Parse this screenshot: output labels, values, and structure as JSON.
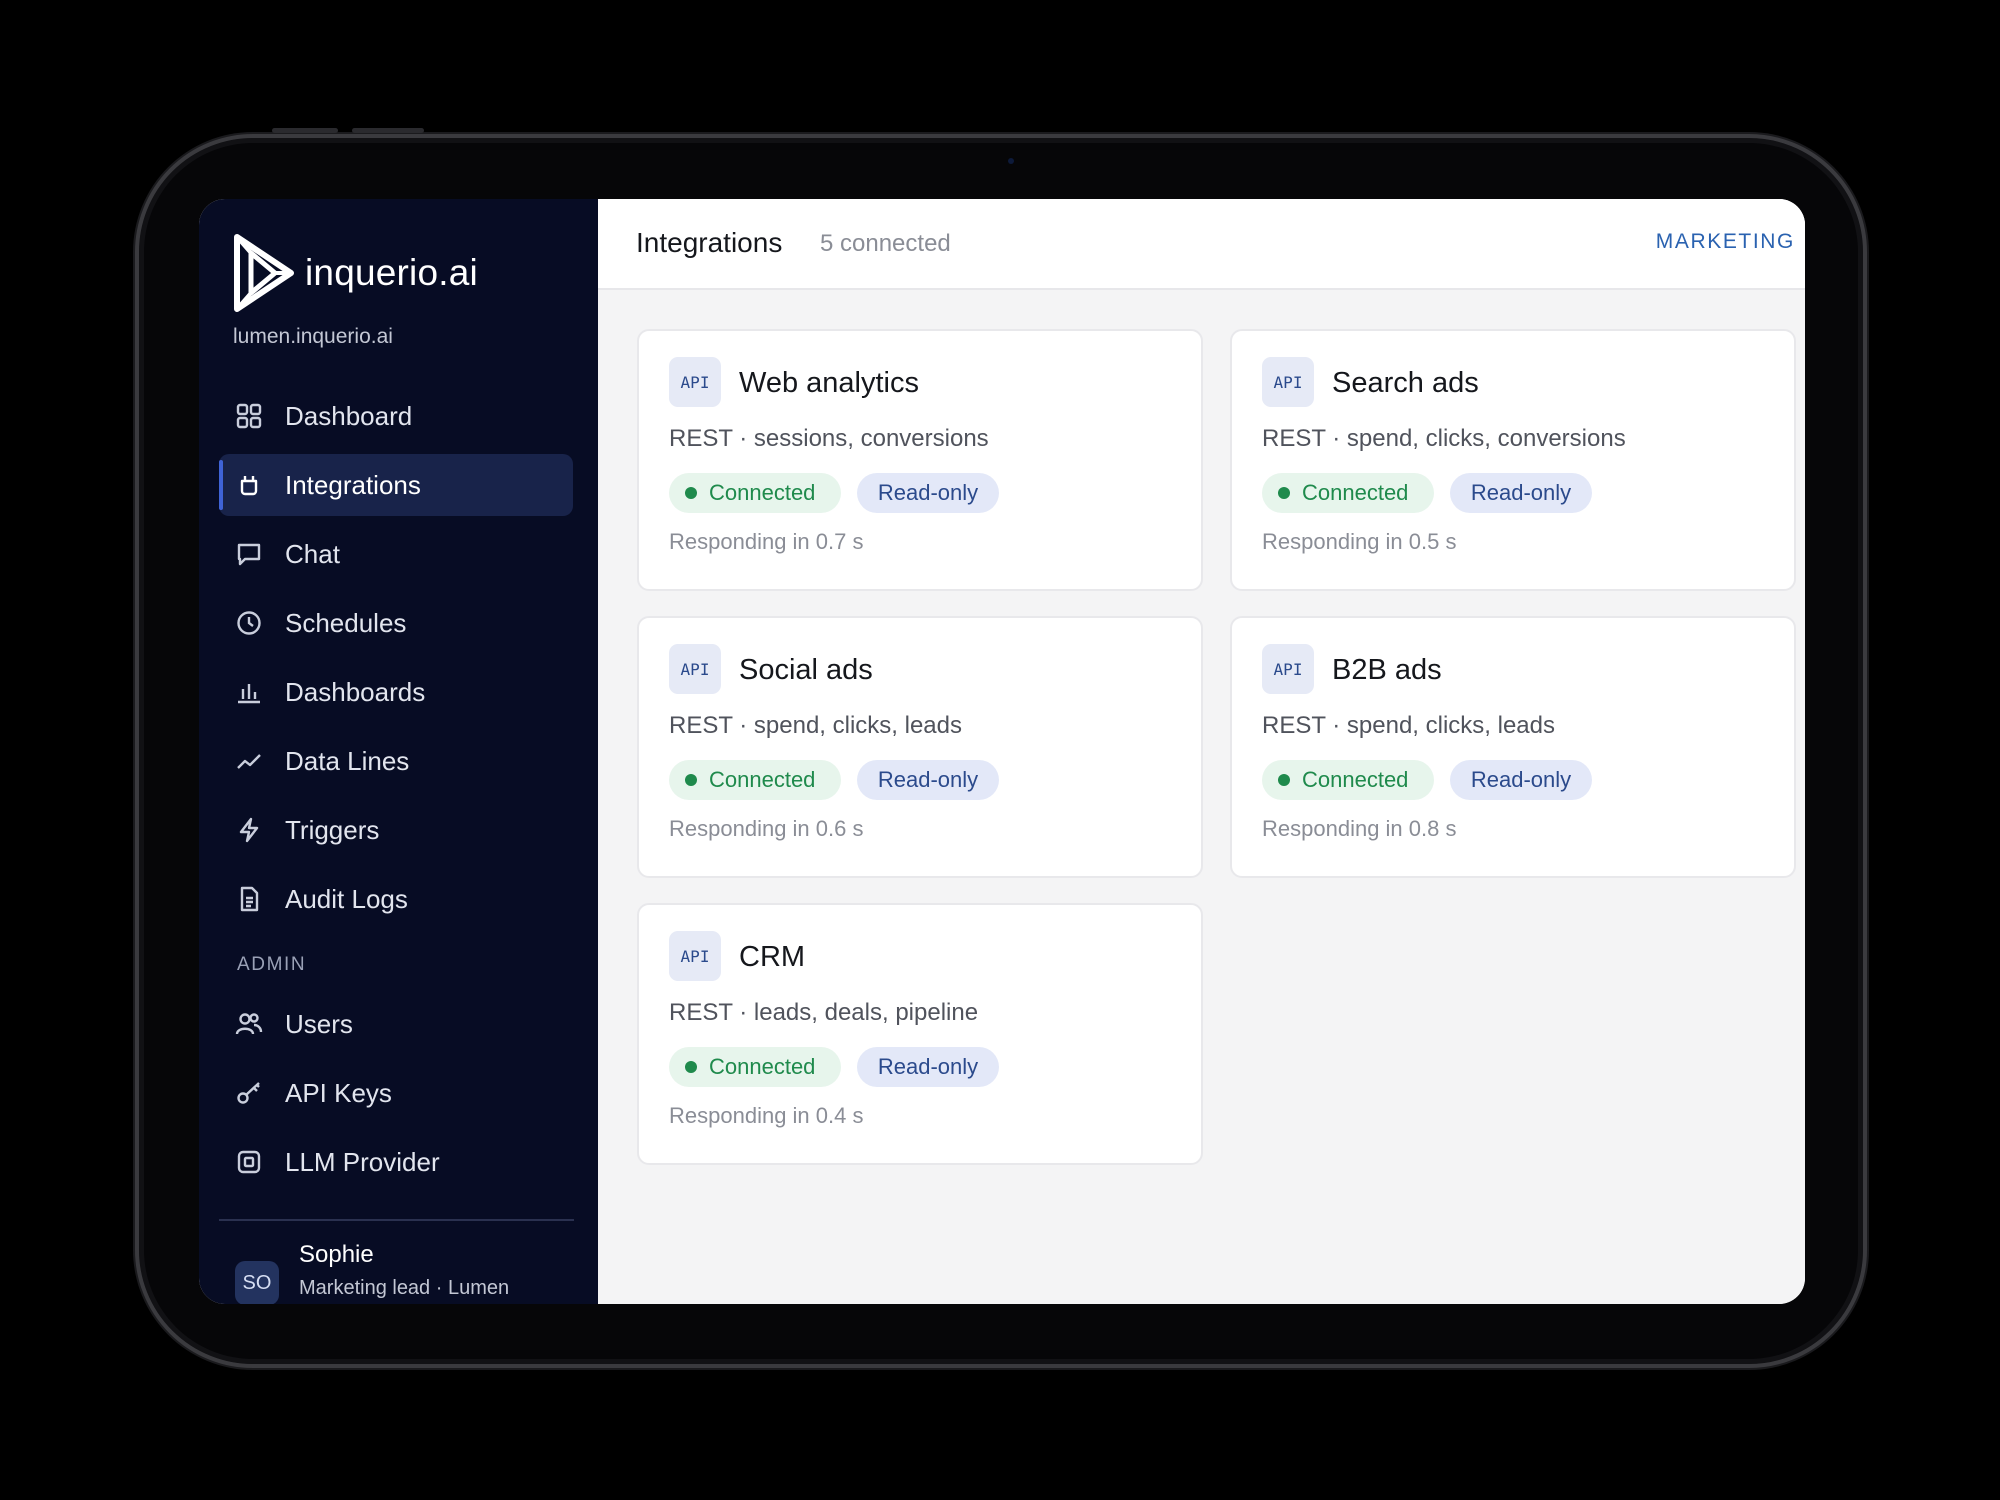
{
  "brand": {
    "name": "inquerio.ai",
    "domain": "lumen.inquerio.ai"
  },
  "sidebar": {
    "items": [
      {
        "label": "Dashboard",
        "icon": "grid-icon",
        "active": false
      },
      {
        "label": "Integrations",
        "icon": "plug-icon",
        "active": true
      },
      {
        "label": "Chat",
        "icon": "chat-icon",
        "active": false
      },
      {
        "label": "Schedules",
        "icon": "clock-icon",
        "active": false
      },
      {
        "label": "Dashboards",
        "icon": "bar-chart-icon",
        "active": false
      },
      {
        "label": "Data Lines",
        "icon": "trend-line-icon",
        "active": false
      },
      {
        "label": "Triggers",
        "icon": "lightning-icon",
        "active": false
      },
      {
        "label": "Audit Logs",
        "icon": "document-icon",
        "active": false
      }
    ],
    "admin_label": "ADMIN",
    "admin_items": [
      {
        "label": "Users",
        "icon": "users-icon"
      },
      {
        "label": "API Keys",
        "icon": "key-icon"
      },
      {
        "label": "LLM Provider",
        "icon": "chip-icon"
      }
    ],
    "user": {
      "initials": "SO",
      "name": "Sophie",
      "role": "Marketing lead · Lumen"
    }
  },
  "header": {
    "title": "Integrations",
    "count": "5 connected",
    "workspace": "MARKETING"
  },
  "cards": [
    {
      "badge": "API",
      "title": "Web analytics",
      "desc": "REST · sessions, conversions",
      "status": "Connected",
      "access": "Read-only",
      "response": "Responding in 0.7 s"
    },
    {
      "badge": "API",
      "title": "Search ads",
      "desc": "REST · spend, clicks, conversions",
      "status": "Connected",
      "access": "Read-only",
      "response": "Responding in 0.5 s"
    },
    {
      "badge": "API",
      "title": "Social ads",
      "desc": "REST · spend, clicks, leads",
      "status": "Connected",
      "access": "Read-only",
      "response": "Responding in 0.6 s"
    },
    {
      "badge": "API",
      "title": "B2B ads",
      "desc": "REST · spend, clicks, leads",
      "status": "Connected",
      "access": "Read-only",
      "response": "Responding in 0.8 s"
    },
    {
      "badge": "API",
      "title": "CRM",
      "desc": "REST · leads, deals, pipeline",
      "status": "Connected",
      "access": "Read-only",
      "response": "Responding in 0.4 s"
    }
  ],
  "colors": {
    "sidebar_bg": "#070c24",
    "active_bg": "#18234a",
    "accent": "#3f63d6",
    "connected": "#1f8a4c",
    "readonly": "#2b4a8c"
  }
}
